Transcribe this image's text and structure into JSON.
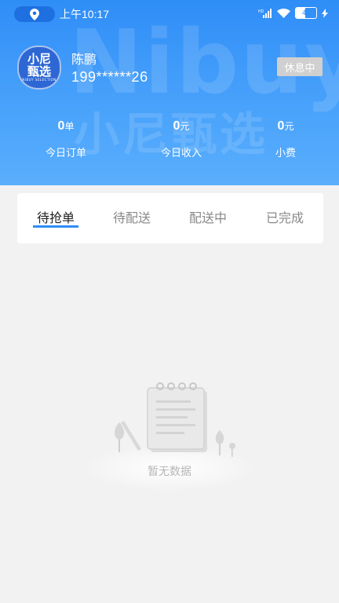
{
  "status_bar": {
    "time": "上午10:17",
    "battery_level": "45",
    "battery_fraction": 0.45,
    "icons": [
      "location-icon",
      "signal-icon",
      "wifi-icon",
      "battery-icon",
      "charging-icon"
    ]
  },
  "brand": {
    "avatar_line1": "小尼",
    "avatar_line2": "甄选",
    "avatar_sub": "NIBUY SELECTION",
    "watermark_en": "Nibuy",
    "watermark_cn": "小尼甄选"
  },
  "profile": {
    "name": "陈鹏",
    "phone": "199******26",
    "status_button": "休息中"
  },
  "stats": [
    {
      "value": "0",
      "unit": "单",
      "label": "今日订单"
    },
    {
      "value": "0",
      "unit": "元",
      "label": "今日收入"
    },
    {
      "value": "0",
      "unit": "元",
      "label": "小费"
    }
  ],
  "tabs": [
    {
      "label": "待抢单",
      "active": true
    },
    {
      "label": "待配送",
      "active": false
    },
    {
      "label": "配送中",
      "active": false
    },
    {
      "label": "已完成",
      "active": false
    }
  ],
  "empty_state": {
    "text": "暂无数据",
    "icon": "empty-notebook-icon"
  },
  "colors": {
    "primary": "#2f8df7",
    "rest_button": "#d0d0d0",
    "background": "#f2f2f2"
  }
}
